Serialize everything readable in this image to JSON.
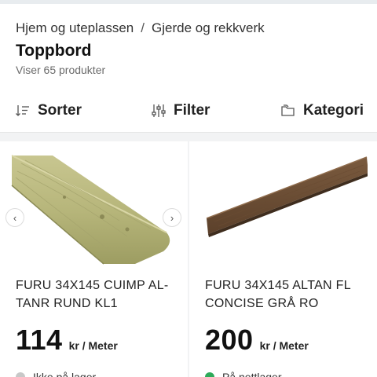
{
  "breadcrumb": {
    "items": [
      "Hjem og uteplassen",
      "Gjerde og rekkverk"
    ],
    "separator": "/"
  },
  "page": {
    "title": "Toppbord",
    "result_count": "Viser 65 produkter"
  },
  "toolbar": {
    "sort_label": "Sorter",
    "filter_label": "Filter",
    "category_label": "Kategori",
    "icons": [
      "sort-icon",
      "filter-sliders-icon",
      "folder-icon"
    ]
  },
  "products": [
    {
      "name": "FURU 34X145 CUIMP AL-TANR RUND KL1",
      "price": "114",
      "unit": "kr / Meter",
      "stock_text": "Ikke på lager",
      "stock_color": "#c8c8c8",
      "carousel": {
        "prev": "‹",
        "next": "›"
      }
    },
    {
      "name": "FURU 34X145 ALTAN FL CONCISE GRÅ RO",
      "price": "200",
      "unit": "kr / Meter",
      "stock_text": "På nettlager",
      "stock_color": "#2eaa5a"
    }
  ],
  "colors": {
    "topbar": "#e8ecef",
    "divider": "#f2f3f4",
    "in_stock": "#2eaa5a"
  }
}
